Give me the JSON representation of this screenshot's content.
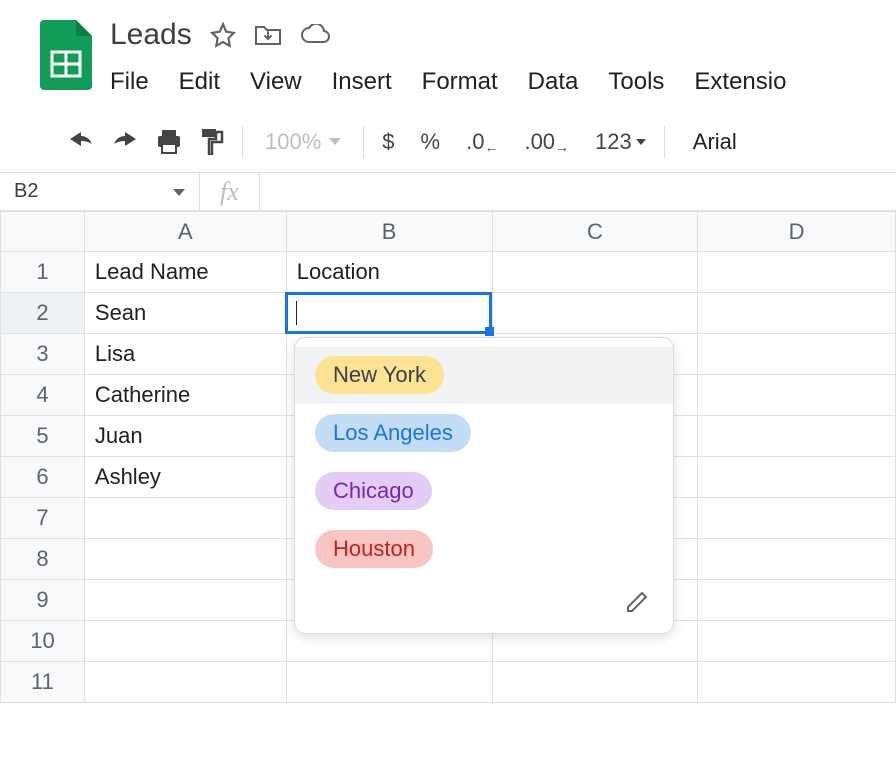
{
  "doc": {
    "title": "Leads"
  },
  "menu": {
    "file": "File",
    "edit": "Edit",
    "view": "View",
    "insert": "Insert",
    "format": "Format",
    "data": "Data",
    "tools": "Tools",
    "extensions": "Extensio"
  },
  "toolbar": {
    "zoom": "100%",
    "currency": "$",
    "percent": "%",
    "dec_decrease": ".0",
    "dec_increase": ".00",
    "numfmt": "123",
    "font": "Arial"
  },
  "namebox": {
    "ref": "B2",
    "fx": "fx"
  },
  "columns": [
    "A",
    "B",
    "C",
    "D"
  ],
  "row_numbers": [
    "1",
    "2",
    "3",
    "4",
    "5",
    "6",
    "7",
    "8",
    "9",
    "10",
    "11"
  ],
  "headers": {
    "lead_name": "Lead Name",
    "location": "Location"
  },
  "leads": {
    "r2": "Sean",
    "r3": "Lisa",
    "r4": "Catherine",
    "r5": "Juan",
    "r6": "Ashley"
  },
  "dropdown": {
    "opt1": "New York",
    "opt2": "Los Angeles",
    "opt3": "Chicago",
    "opt4": "Houston"
  },
  "colors": {
    "brand_green": "#0f9d58",
    "selection_blue": "#1a73e8"
  }
}
